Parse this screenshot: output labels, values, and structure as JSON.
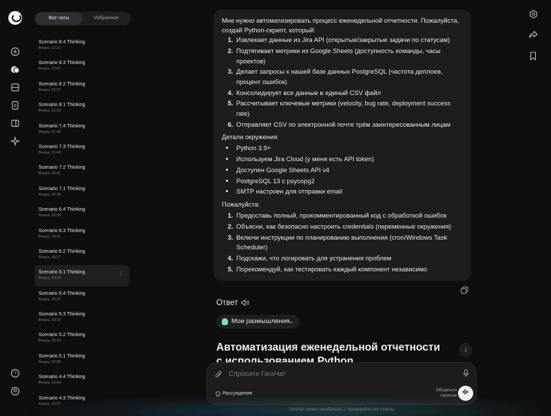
{
  "sidebar": {
    "tabs": [
      {
        "label": "Все чаты",
        "active": true
      },
      {
        "label": "Избранное",
        "active": false
      }
    ],
    "chats": [
      {
        "title": "Scenario 8.4 Thinking",
        "time": "Вчера, 22:12"
      },
      {
        "title": "Scenario 8.3 Thinking",
        "time": "Вчера, 22:07"
      },
      {
        "title": "Scenario 8.2 Thinking",
        "time": "Вчера, 21:57"
      },
      {
        "title": "Scenario 8.1 Thinking",
        "time": "Вчера, 21:53"
      },
      {
        "title": "Scenario 7.4 Thinking",
        "time": "Вчера, 21:49"
      },
      {
        "title": "Scenario 7.3 Thinking",
        "time": "Вчера, 21:43"
      },
      {
        "title": "Scenario 7.2 Thinking",
        "time": "Вчера, 20:41"
      },
      {
        "title": "Scenario 7.1 Thinking",
        "time": "Вчера, 20:38"
      },
      {
        "title": "Scenario 6.4 Thinking",
        "time": "Вчера, 20:35"
      },
      {
        "title": "Scenario 6.3 Thinking",
        "time": "Вчера, 20:31"
      },
      {
        "title": "Scenario 6.2 Thinking",
        "time": "Вчера, 20:27"
      },
      {
        "title": "Scenario 6.1 Thinking",
        "time": "Вчера, 20:24",
        "selected": true
      },
      {
        "title": "Scenario 5.4 Thinking",
        "time": "Вчера, 20:21"
      },
      {
        "title": "Scenario 5.3 Thinking",
        "time": "Вчера, 20:18"
      },
      {
        "title": "Scenario 5.2 Thinking",
        "time": "Вчера, 20:13"
      },
      {
        "title": "Scenario 5.1 Thinking",
        "time": "Вчера, 20:08"
      },
      {
        "title": "Scenario 4.4 Thinking",
        "time": "Вчера, 20:04"
      },
      {
        "title": "Scenario 4.3 Thinking",
        "time": "Вчера, 19:37"
      }
    ]
  },
  "rail_icons": [
    "new-chat-icon",
    "chats-icon",
    "saved-icon",
    "documents-icon",
    "media-icon",
    "sparkle-icon",
    "help-icon",
    "profile-icon"
  ],
  "right_icons": [
    "settings-icon",
    "share-icon",
    "bookmark-icon"
  ],
  "message": {
    "intro": "Мне нужно автоматизировать процесс еженедельной отчетности. Пожалуйста, создай Python-скрипт, который:",
    "tasks": [
      "Извлекает данные из Jira API (открытые/закрытые задачи по статусам)",
      "Подтягивает метрики из Google Sheets (доступность команды, часы проектов)",
      "Делает запросы к нашей базе данных PostgreSQL (частота деплоев, процент ошибок)",
      "Консолидирует все данные в единый CSV файл",
      "Рассчитывает ключевые метрики (velocity, bug rate, deployment success rate)",
      "Отправляет CSV по электронной почте трём заинтересованным лицам"
    ],
    "env_title": "Детали окружения:",
    "env": [
      "Python 3.9+",
      "Используем Jira Cloud (у меня есть API token)",
      "Доступен Google Sheets API v4",
      "PostgreSQL 13 с psycopg2",
      "SMTP настроен для отправки email"
    ],
    "please_title": "Пожалуйста:",
    "requests": [
      "Предоставь полный, прокомментированный код с обработкой ошибок",
      "Объясни, как безопасно настроить credentials (переменные окружения)",
      "Включи инструкции по планированию выполнения (cron/Windows Task Scheduler)",
      "Подскажи, что логировать для устранения проблем",
      "Порекомендуй, как тестировать каждый компонент независимо"
    ]
  },
  "answer": {
    "label": "Ответ",
    "thoughts_label": "Мои размышления",
    "heading": "Автоматизация еженедельной отчетности с использованием Python"
  },
  "composer": {
    "placeholder": "Спросите ГигаЧат",
    "mailing_label": "Рассуждение",
    "voice_label": "Общаться голосом"
  },
  "disclaimer": "ГигаЧат может ошибаться — проверяйте его ответы"
}
